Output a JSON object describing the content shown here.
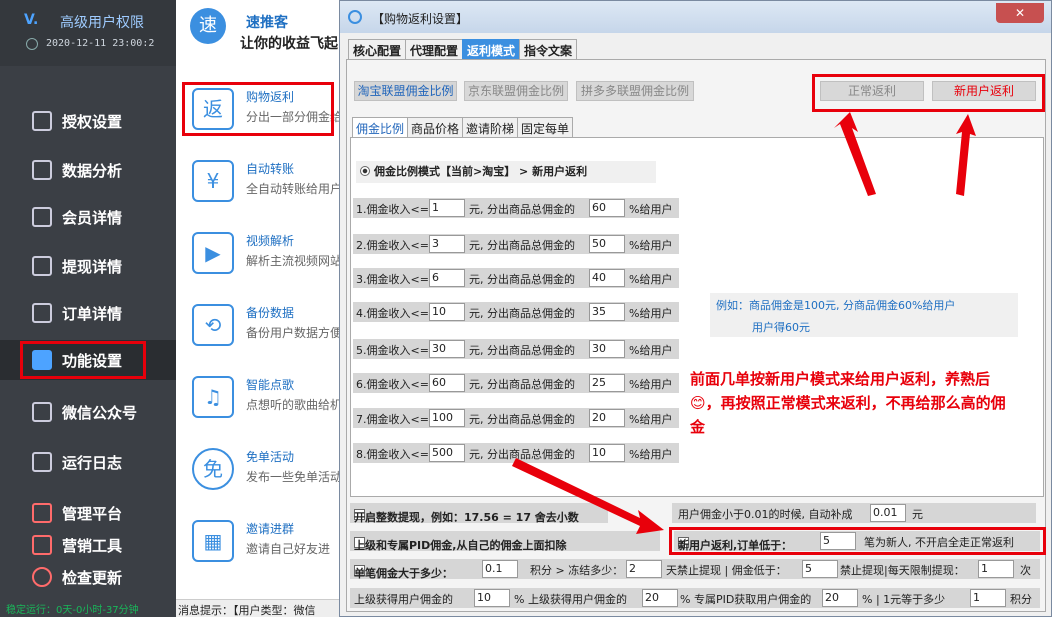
{
  "sidebar": {
    "app_title": "高级用户权限",
    "datetime": "2020-12-11 23:00:2",
    "items": [
      {
        "label": "授权设置",
        "icon": "key-icon"
      },
      {
        "label": "数据分析",
        "icon": "chart-icon"
      },
      {
        "label": "会员详情",
        "icon": "edit-icon"
      },
      {
        "label": "提现详情",
        "icon": "search-doc-icon"
      },
      {
        "label": "订单详情",
        "icon": "order-icon"
      },
      {
        "label": "功能设置",
        "icon": "wechat-icon"
      },
      {
        "label": "微信公众号",
        "icon": "gongzhonghao-icon"
      },
      {
        "label": "运行日志",
        "icon": "speaker-icon"
      },
      {
        "label": "管理平台",
        "icon": "server-icon"
      },
      {
        "label": "营销工具",
        "icon": "tools-icon"
      },
      {
        "label": "检查更新",
        "icon": "update-icon"
      }
    ],
    "status": "稳定运行：0天-0小时-37分钟"
  },
  "mid": {
    "brand": "速推客",
    "brand_icon": "速",
    "slogan": "让你的收益飞起",
    "features": [
      {
        "title": "购物返利",
        "desc": "分出一部分佣金给",
        "icon": "返"
      },
      {
        "title": "自动转账",
        "desc": "全自动转账给用户",
        "icon": "¥"
      },
      {
        "title": "视频解析",
        "desc": "解析主流视频网站",
        "icon": "▶"
      },
      {
        "title": "备份数据",
        "desc": "备份用户数据方便",
        "icon": "⟲"
      },
      {
        "title": "智能点歌",
        "desc": "点想听的歌曲给机",
        "icon": "♫"
      },
      {
        "title": "免单活动",
        "desc": "发布一些免单活动",
        "icon": "免"
      },
      {
        "title": "邀请进群",
        "desc": "邀请自己好友进",
        "icon": "▦"
      }
    ],
    "bottom_bar": "消息提示：【用户类型：微信"
  },
  "dialog": {
    "title": "【购物返利设置】",
    "close": "✕",
    "tabs": [
      "核心配置",
      "代理配置",
      "返利模式",
      "指令文案"
    ],
    "platform_buttons": [
      "淘宝联盟佣金比例",
      "京东联盟佣金比例",
      "拼多多联盟佣金比例"
    ],
    "mode_buttons": [
      "正常返利",
      "新用户返利"
    ],
    "subtabs": [
      "佣金比例",
      "商品价格",
      "邀请阶梯",
      "固定每单"
    ],
    "mode_text": "佣金比例模式【当前>淘宝】 > 新用户返利",
    "row_text": {
      "mid": "元, 分出商品总佣金的",
      "end": "%给用户"
    },
    "rows": [
      {
        "prefix": "1.佣金收入<=",
        "amount": "1",
        "percent": "60"
      },
      {
        "prefix": "2.佣金收入<=",
        "amount": "3",
        "percent": "50"
      },
      {
        "prefix": "3.佣金收入<=",
        "amount": "6",
        "percent": "40"
      },
      {
        "prefix": "4.佣金收入<=",
        "amount": "10",
        "percent": "35"
      },
      {
        "prefix": "5.佣金收入<=",
        "amount": "30",
        "percent": "30"
      },
      {
        "prefix": "6.佣金收入<=",
        "amount": "60",
        "percent": "25"
      },
      {
        "prefix": "7.佣金收入<=",
        "amount": "100",
        "percent": "20"
      },
      {
        "prefix": "8.佣金收入<=",
        "amount": "500",
        "percent": "10"
      }
    ],
    "example_line1": "例如：商品佣金是100元, 分商品佣金60%给用户",
    "example_line2": "用户得60元",
    "annotation": "前面几单按新用户模式来给用户返利，养熟后😊，再按照正常模式来返利，不再给那么高的佣金",
    "bottom": {
      "integer_label": "开启整数提现，例如：17.56 = 17 舍去小数",
      "compensate_label": "用户佣金小于0.01的时候, 自动补成",
      "compensate_value": "0.01",
      "compensate_unit": "元",
      "pid_label": "上级和专属PID佣金,从自己的佣金上面扣除",
      "newuser_label": "新用户返利,订单低于：",
      "newuser_value": "5",
      "newuser_suffix": "笔为新人, 不开启全走正常返利",
      "single_label": "单笔佣金大于多少：",
      "single_value": "0.1",
      "freeze_label": "积分 > 冻结多少：",
      "freeze_value": "2",
      "ban_label": "天禁止提现 | 佣金低于：",
      "ban_value": "5",
      "limit_label": "禁止提现|每天限制提现：",
      "limit_value": "1",
      "limit_unit": "次",
      "upper_label": "上级获得用户佣金的",
      "upper_value": "10",
      "upper2_label": "%  上级获得用户佣金的",
      "upper2_value": "20",
      "pid2_label": "% 专属PID获取用户佣金的",
      "pid2_value": "20",
      "rate_label": "%  |  1元等于多少",
      "rate_value": "1",
      "rate_unit": "积分"
    }
  },
  "colors": {
    "accent": "#3b8fe0",
    "highlight": "#e8000b",
    "sidebar_bg": "#3b3f45"
  }
}
